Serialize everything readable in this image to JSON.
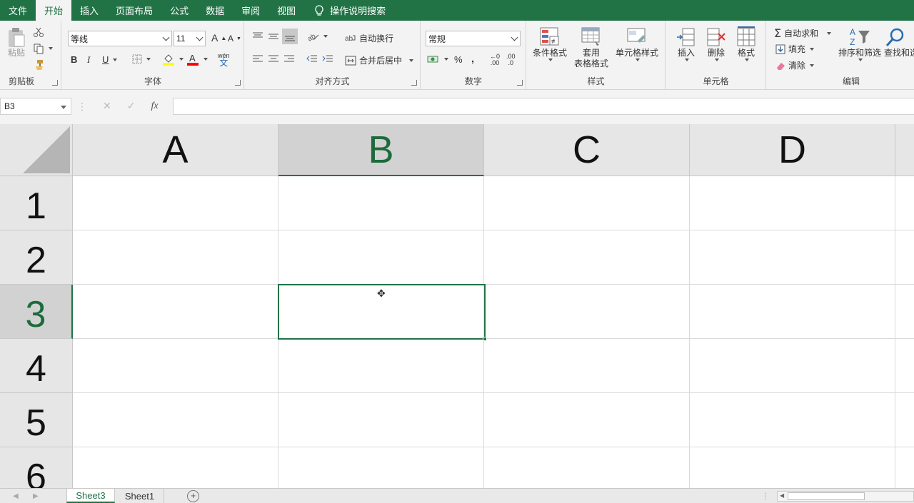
{
  "menu": {
    "tabs": [
      "文件",
      "开始",
      "插入",
      "页面布局",
      "公式",
      "数据",
      "审阅",
      "视图"
    ],
    "active_tab": "开始",
    "tell_me": "操作说明搜索"
  },
  "ribbon": {
    "clipboard": {
      "label": "剪贴板",
      "paste": "粘贴"
    },
    "font": {
      "label": "字体",
      "font_name": "等线",
      "font_size": "11",
      "bold": "B",
      "italic": "I",
      "underline": "U",
      "grow": "A",
      "shrink": "A",
      "font_color": "A",
      "phonetic": "wén"
    },
    "alignment": {
      "label": "对齐方式",
      "wrap_text": "自动换行",
      "merge_center": "合并后居中"
    },
    "number": {
      "label": "数字",
      "format": "常规",
      "percent": "%",
      "comma": ",",
      "inc_decimal": ".00",
      "dec_decimal": ".0"
    },
    "styles": {
      "label": "样式",
      "conditional": "条件格式",
      "table_line1": "套用",
      "table_line2": "表格格式",
      "cell_styles": "单元格样式"
    },
    "cells": {
      "label": "单元格",
      "insert": "插入",
      "delete": "删除",
      "format": "格式"
    },
    "editing": {
      "label": "编辑",
      "autosum": "自动求和",
      "fill": "填充",
      "clear": "清除",
      "sort_filter": "排序和筛选",
      "find_select": "查找和选择"
    }
  },
  "formula_bar": {
    "name_box": "B3",
    "cancel": "✕",
    "enter": "✓",
    "fx": "fx",
    "value": ""
  },
  "grid": {
    "columns": [
      "A",
      "B",
      "C",
      "D"
    ],
    "rows": [
      "1",
      "2",
      "3",
      "4",
      "5",
      "6"
    ],
    "selected_column": "B",
    "selected_row": "3"
  },
  "sheets": {
    "tabs": [
      "Sheet3",
      "Sheet1"
    ],
    "active": "Sheet3",
    "add": "+"
  },
  "colors": {
    "accent": "#217346",
    "header_bg": "#e6e6e6",
    "header_sel_bg": "#d2d2d2"
  }
}
